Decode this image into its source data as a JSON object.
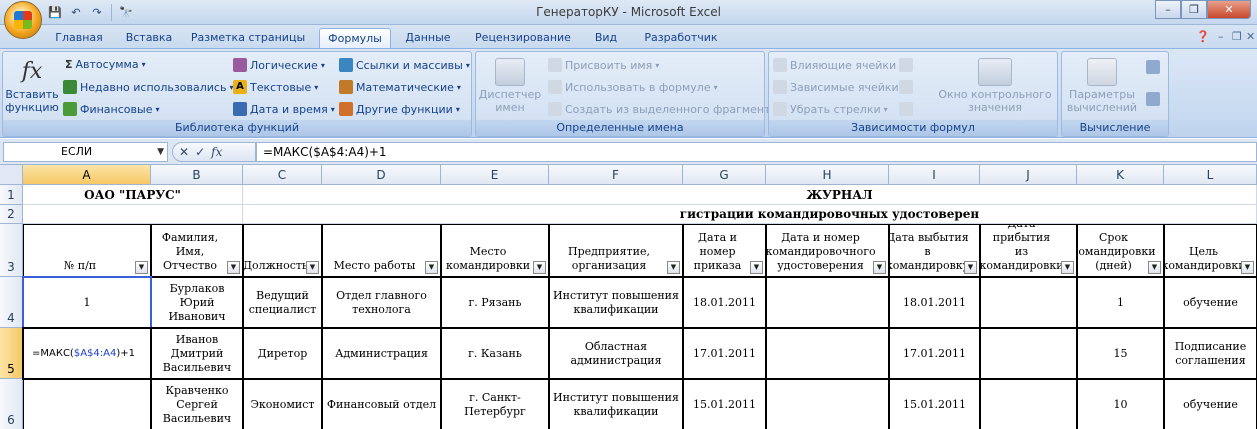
{
  "window": {
    "title": "ГенераторКУ - Microsoft Excel",
    "controls": {
      "minimize": "–",
      "restore": "❐",
      "close": "✕"
    }
  },
  "qat": {
    "save": "💾",
    "undo": "↶",
    "redo": "↷",
    "extra": "🔭"
  },
  "tabs": [
    "Главная",
    "Вставка",
    "Разметка страницы",
    "Формулы",
    "Данные",
    "Рецензирование",
    "Вид",
    "Разработчик"
  ],
  "active_tab": "Формулы",
  "ribbon": {
    "insert_function": "Вставить\nфункцию",
    "library": {
      "autosum": "Автосумма",
      "recent": "Недавно использовались",
      "financial": "Финансовые",
      "logical": "Логические",
      "text": "Текстовые",
      "datetime": "Дата и время",
      "lookup": "Ссылки и массивы",
      "math": "Математические",
      "other": "Другие функции",
      "label": "Библиотека функций"
    },
    "names": {
      "manager": "Диспетчер\nимен",
      "assign": "Присвоить имя",
      "use": "Использовать в формуле",
      "create": "Создать из выделенного фрагмента",
      "label": "Определенные имена"
    },
    "audit": {
      "precedents": "Влияющие ячейки",
      "dependents": "Зависимые ячейки",
      "remove": "Убрать стрелки",
      "watch": "Окно контрольного\nзначения",
      "label": "Зависимости формул"
    },
    "calc": {
      "options": "Параметры\nвычислений",
      "label": "Вычисление"
    }
  },
  "formula_bar": {
    "name_box": "ЕСЛИ",
    "formula": "=МАКС($A$4:A4)+1"
  },
  "columns": [
    "A",
    "B",
    "C",
    "D",
    "E",
    "F",
    "G",
    "H",
    "I",
    "J",
    "K",
    "L"
  ],
  "rows": [
    "1",
    "2",
    "3",
    "4",
    "5",
    "6"
  ],
  "sheet": {
    "company": "ОАО \"ПАРУС\"",
    "journal_title": "ЖУРНАЛ",
    "journal_subtitle": "гистрации командировочных удостоверен",
    "headers": [
      "№ п/п",
      "Фамилия, Имя,\nОтчество",
      "Должность",
      "Место работы",
      "Место\nкомандировки",
      "Предприятие,\nорганизация",
      "Дата и номер\nприказа",
      "Дата и номер\nкомандировочного\nудостоверения",
      "Дата выбытия\nв\nкомандировку",
      "Дата прибытия\nиз\nкомандировки",
      "Срок\nкомандировки\n(дней)",
      "Цель\nкомандировки"
    ],
    "data": [
      [
        "1",
        "Бурлаков\nЮрий\nИванович",
        "Ведущий\nспециалист",
        "Отдел главного\nтехнолога",
        "г. Рязань",
        "Институт повышения\nквалификации",
        "18.01.2011",
        "",
        "18.01.2011",
        "",
        "1",
        "обучение"
      ],
      [
        "",
        "Иванов\nДмитрий\nВасильевич",
        "Диретор",
        "Администрация",
        "г. Казань",
        "Областная\nадминистрация",
        "17.01.2011",
        "",
        "17.01.2011",
        "",
        "15",
        "Подписание\nсоглашения"
      ],
      [
        "",
        "Кравченко\nСергей\nВасильевич",
        "Экономист",
        "Финансовый отдел",
        "г. Санкт-\nПетербург",
        "Институт повышения\nквалификации",
        "15.01.2011",
        "",
        "15.01.2011",
        "",
        "10",
        "обучение"
      ]
    ],
    "edit_formula_prefix": "=МАКС(",
    "edit_formula_ref": "$A$4:A4",
    "edit_formula_suffix": ")+1"
  }
}
